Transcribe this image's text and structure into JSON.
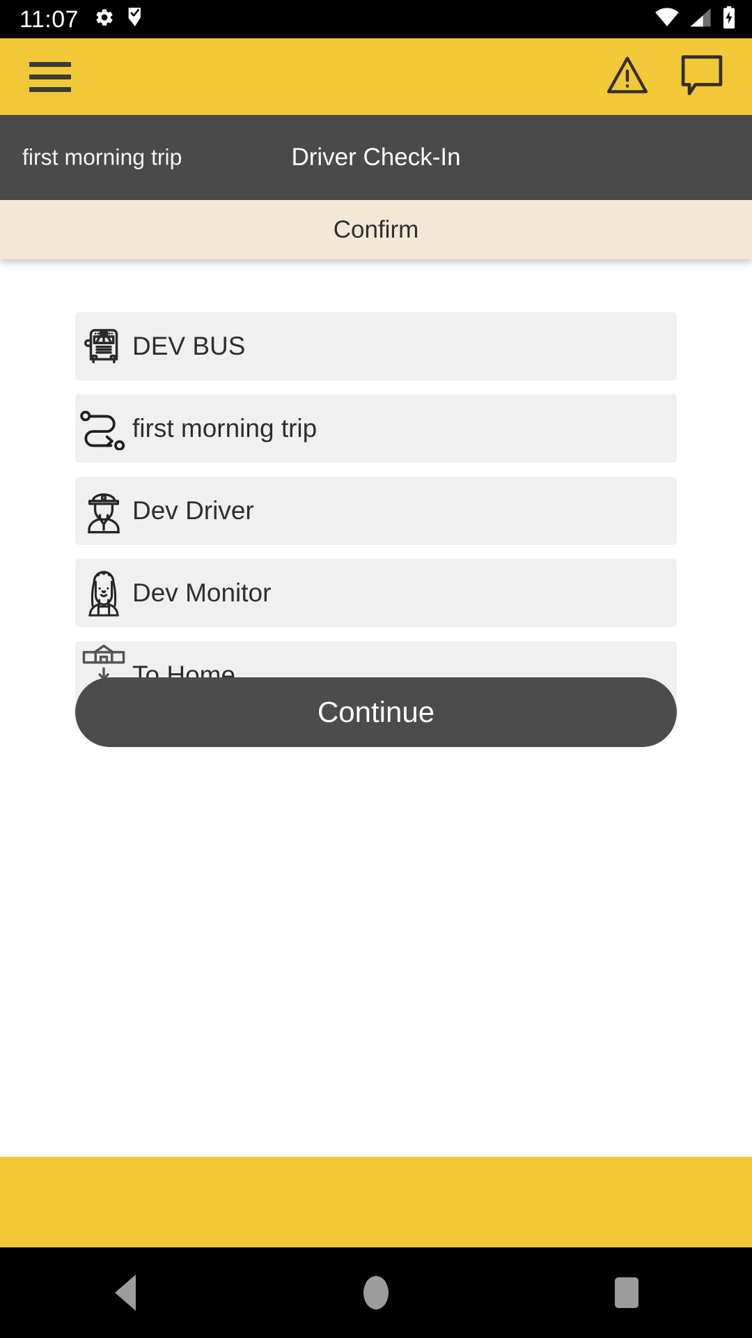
{
  "status_bar": {
    "time": "11:07",
    "left_icons": [
      "gear-icon",
      "flag-check-icon"
    ],
    "right_icons": [
      "wifi-icon",
      "cellular-signal-icon",
      "battery-charging-icon"
    ]
  },
  "app_bar": {
    "menu_icon": "hamburger-menu-icon",
    "actions": [
      "warning-triangle-icon",
      "chat-bubble-icon"
    ],
    "background_color": "#F2C738"
  },
  "sub_header": {
    "trip_name": "first morning trip",
    "title": "Driver Check-In",
    "background_color": "#4A4A4A"
  },
  "tab_bar": {
    "label": "Confirm",
    "background_color": "#F2E8D5"
  },
  "summary_rows": [
    {
      "icon": "school-bus-icon",
      "label": "DEV BUS"
    },
    {
      "icon": "route-path-icon",
      "label": "first morning trip"
    },
    {
      "icon": "driver-icon",
      "label": "Dev Driver"
    },
    {
      "icon": "monitor-icon",
      "label": "Dev Monitor"
    },
    {
      "icon": "school-to-home-icon",
      "label": "To Home"
    }
  ],
  "primary_action": {
    "label": "Continue",
    "background_color": "#4C4C4C"
  },
  "nav_bar": {
    "buttons": [
      "back-button",
      "home-button",
      "recents-button"
    ]
  }
}
